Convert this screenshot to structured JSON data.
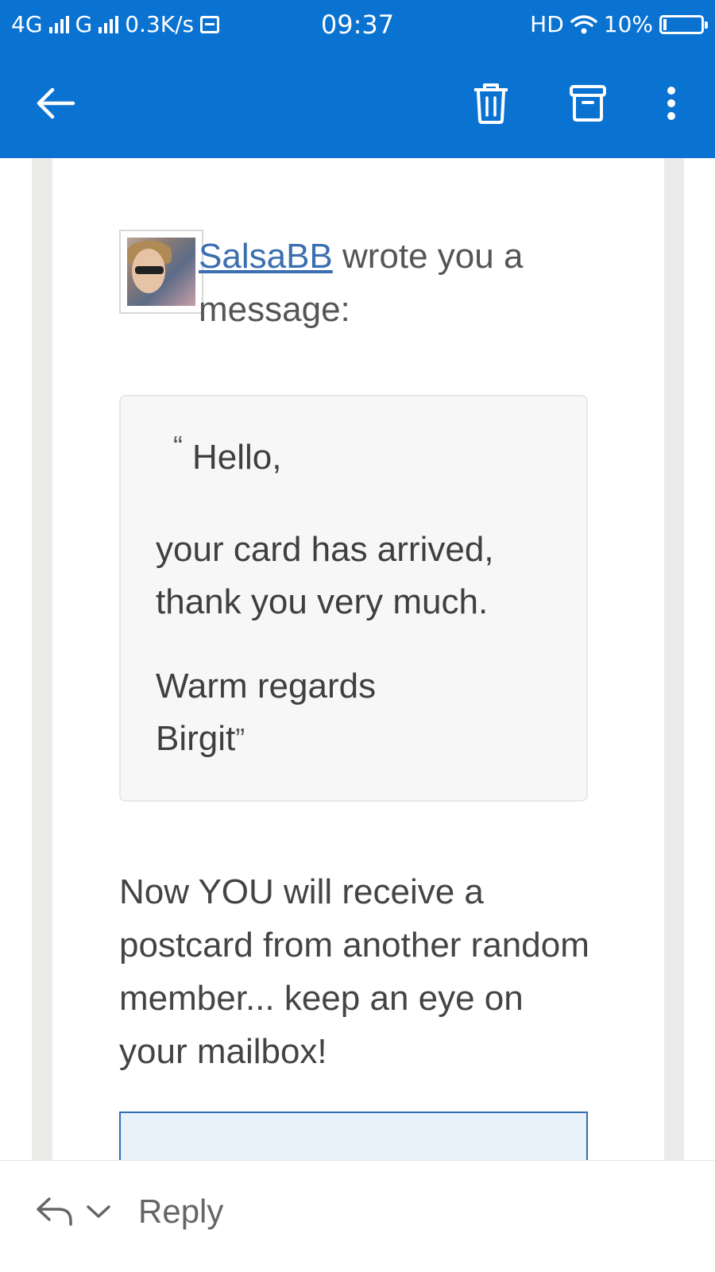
{
  "status_bar": {
    "network_1": "4G",
    "network_2": "G",
    "speed": "0.3K/s",
    "time": "09:37",
    "hd": "HD",
    "battery": "10%"
  },
  "toolbar": {
    "back_icon": "arrow-left-icon",
    "delete_icon": "trash-icon",
    "archive_icon": "archive-icon",
    "more_icon": "more-vertical-icon"
  },
  "message": {
    "sender_name": "SalsaBB",
    "sender_suffix": " wrote you a message:",
    "quote": {
      "open_mark": "“",
      "hello": "Hello,",
      "line1": "your card has arrived,",
      "line2": "thank you very much.",
      "line3": "Warm regards",
      "line4": "Birgit",
      "close_mark": "”"
    },
    "body": "Now YOU will receive a postcard from another random member... keep an eye on your mailbox!"
  },
  "bottom_bar": {
    "reply_label": "Reply"
  },
  "colors": {
    "accent": "#0a72d1",
    "link": "#3b6fb0"
  }
}
